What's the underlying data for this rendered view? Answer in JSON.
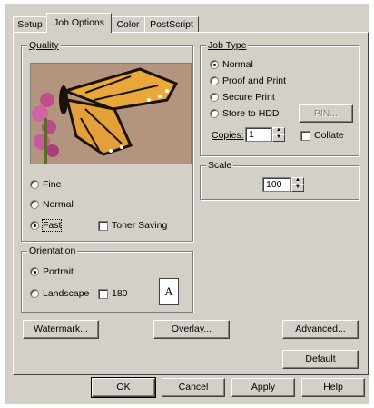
{
  "tabs": [
    "Setup",
    "Job Options",
    "Color",
    "PostScript"
  ],
  "quality": {
    "legend": "Quality",
    "options": [
      "Fine",
      "Normal",
      "Fast"
    ],
    "selected": "Fast",
    "toner_saving_label": "Toner Saving"
  },
  "job_type": {
    "legend": "Job Type",
    "options": [
      "Normal",
      "Proof and Print",
      "Secure Print",
      "Store to HDD"
    ],
    "selected": "Normal",
    "pin_button": "PIN...",
    "copies_label": "Copies:",
    "copies_value": "1",
    "collate_label": "Collate"
  },
  "scale": {
    "legend": "Scale",
    "value": "100"
  },
  "orientation": {
    "legend": "Orientation",
    "portrait_label": "Portrait",
    "landscape_label": "Landscape",
    "rotate_label": "180",
    "selected": "Portrait",
    "page_icon_letter": "A"
  },
  "buttons": {
    "watermark": "Watermark...",
    "overlay": "Overlay...",
    "advanced": "Advanced...",
    "default": "Default"
  },
  "footer": {
    "ok": "OK",
    "cancel": "Cancel",
    "apply": "Apply",
    "help": "Help"
  }
}
